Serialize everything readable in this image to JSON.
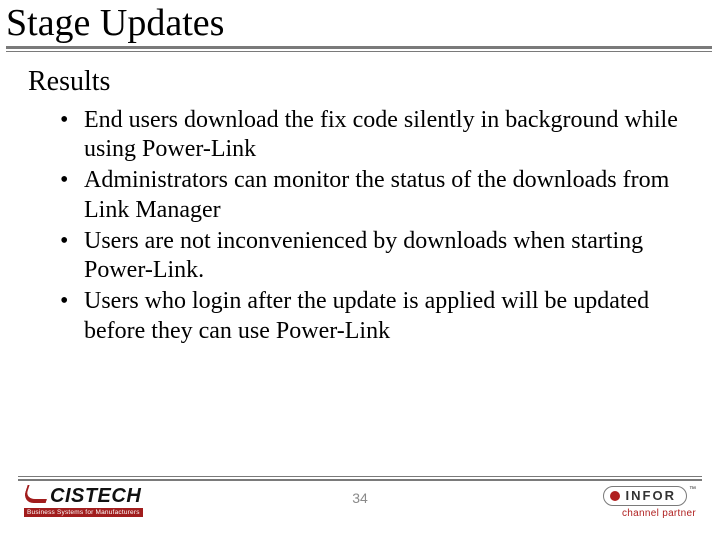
{
  "title": "Stage Updates",
  "subhead": "Results",
  "bullets": [
    "End users download the fix code silently in background while using Power-Link",
    "Administrators can monitor the status of the downloads from Link Manager",
    "Users are not inconvenienced by downloads when starting Power-Link.",
    "Users who login after the update is applied will be updated before they can use Power-Link"
  ],
  "page_number": "34",
  "logos": {
    "left": {
      "name": "CISTECH",
      "tagline": "Business Systems for Manufacturers"
    },
    "right": {
      "name": "INFOR",
      "sub": "channel partner"
    }
  }
}
